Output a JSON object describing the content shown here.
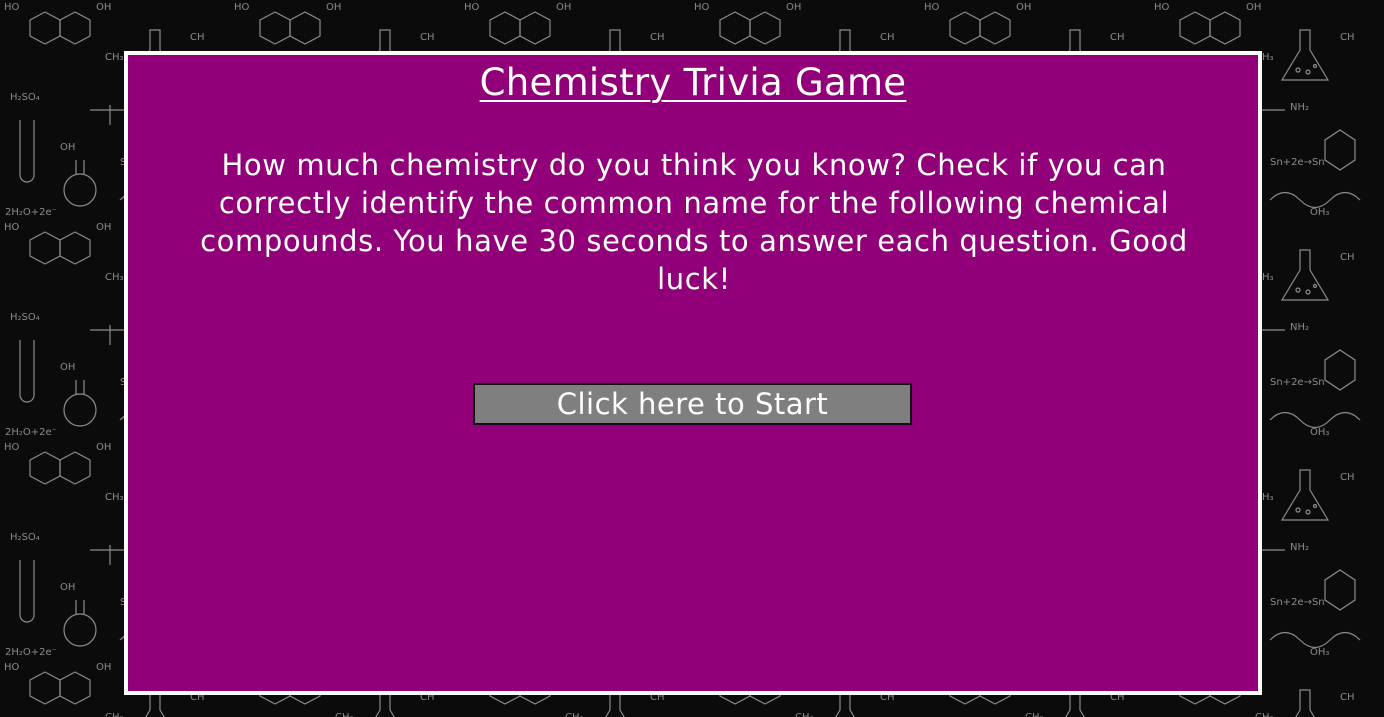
{
  "page": {
    "title": "Chemistry Trivia Game",
    "intro": "How much chemistry do you think you know? Check if you can correctly identify the common name for the following chemical compounds. You have 30 seconds to answer each question. Good luck!",
    "start_button_label": "Click here to Start"
  },
  "colors": {
    "panel_background": "#910079",
    "panel_border": "#ffffff",
    "button_background": "#7f7f7f",
    "page_background": "#0b0b0b",
    "text": "#ffffff"
  },
  "background": {
    "description_icon": "chemistry-doodle-pattern"
  }
}
